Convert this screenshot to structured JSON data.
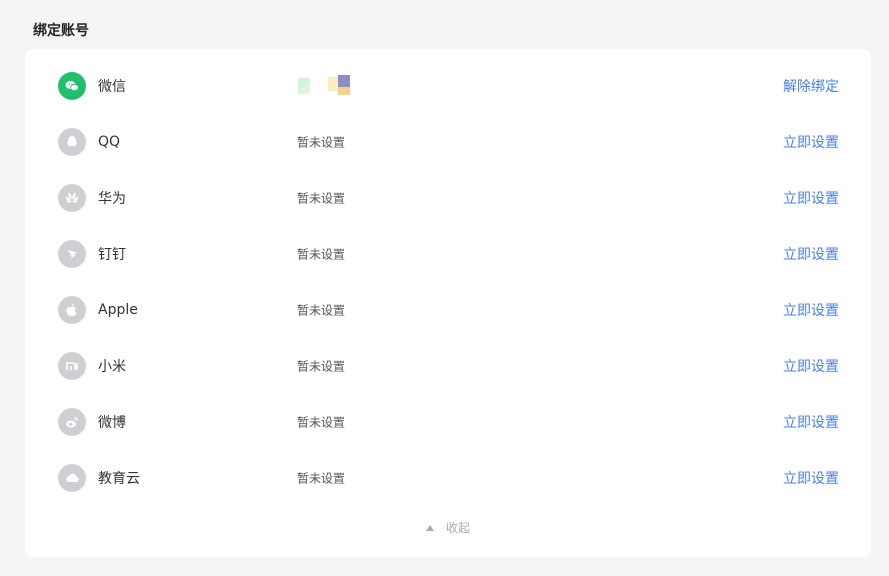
{
  "section": {
    "title": "绑定账号"
  },
  "accounts": [
    {
      "name": "微信",
      "status": "",
      "action": "解除绑定",
      "icon": "wechat-icon",
      "bound": true
    },
    {
      "name": "QQ",
      "status": "暂未设置",
      "action": "立即设置",
      "icon": "qq-icon",
      "bound": false
    },
    {
      "name": "华为",
      "status": "暂未设置",
      "action": "立即设置",
      "icon": "huawei-icon",
      "bound": false
    },
    {
      "name": "钉钉",
      "status": "暂未设置",
      "action": "立即设置",
      "icon": "dingtalk-icon",
      "bound": false
    },
    {
      "name": "Apple",
      "status": "暂未设置",
      "action": "立即设置",
      "icon": "apple-icon",
      "bound": false
    },
    {
      "name": "小米",
      "status": "暂未设置",
      "action": "立即设置",
      "icon": "xiaomi-icon",
      "bound": false
    },
    {
      "name": "微博",
      "status": "暂未设置",
      "action": "立即设置",
      "icon": "weibo-icon",
      "bound": false
    },
    {
      "name": "教育云",
      "status": "暂未设置",
      "action": "立即设置",
      "icon": "cloud-icon",
      "bound": false
    }
  ],
  "footer": {
    "collapse_label": "收起"
  },
  "colors": {
    "link": "#4a7df0",
    "wechat": "#1fbf6b",
    "icon_inactive": "#cfcfd3"
  }
}
